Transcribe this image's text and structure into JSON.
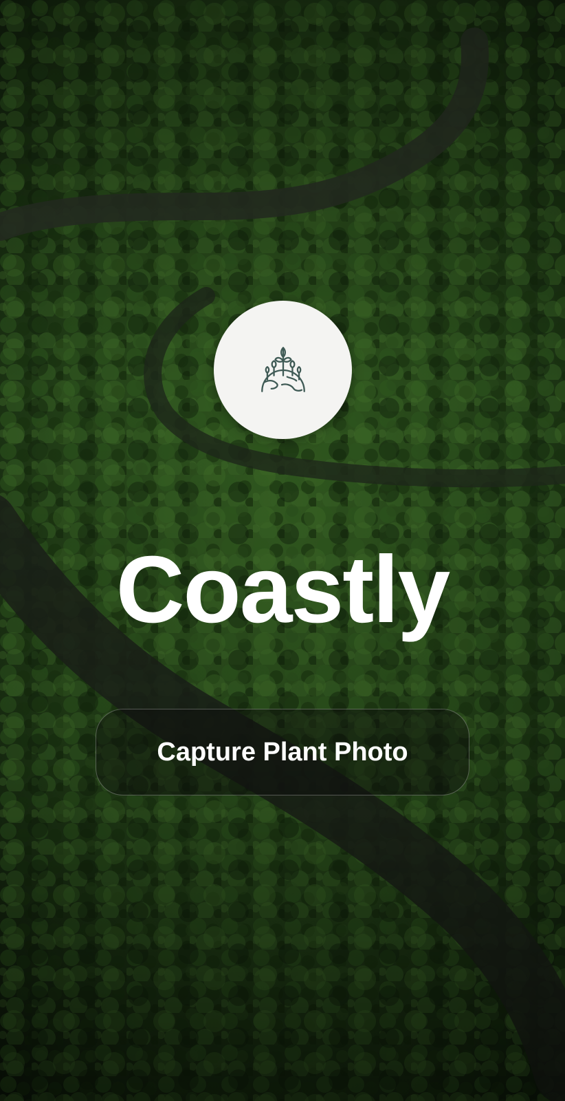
{
  "app": {
    "name": "Coastly",
    "logo_icon": "globe-sprout-icon"
  },
  "actions": {
    "capture_label": "Capture Plant Photo"
  },
  "colors": {
    "logo_circle_bg": "#f4f4f2",
    "logo_icon_stroke": "#3f5a55",
    "title_text": "#ffffff",
    "button_text": "#ffffff"
  },
  "background": {
    "subject": "aerial-forest-river-photo"
  }
}
